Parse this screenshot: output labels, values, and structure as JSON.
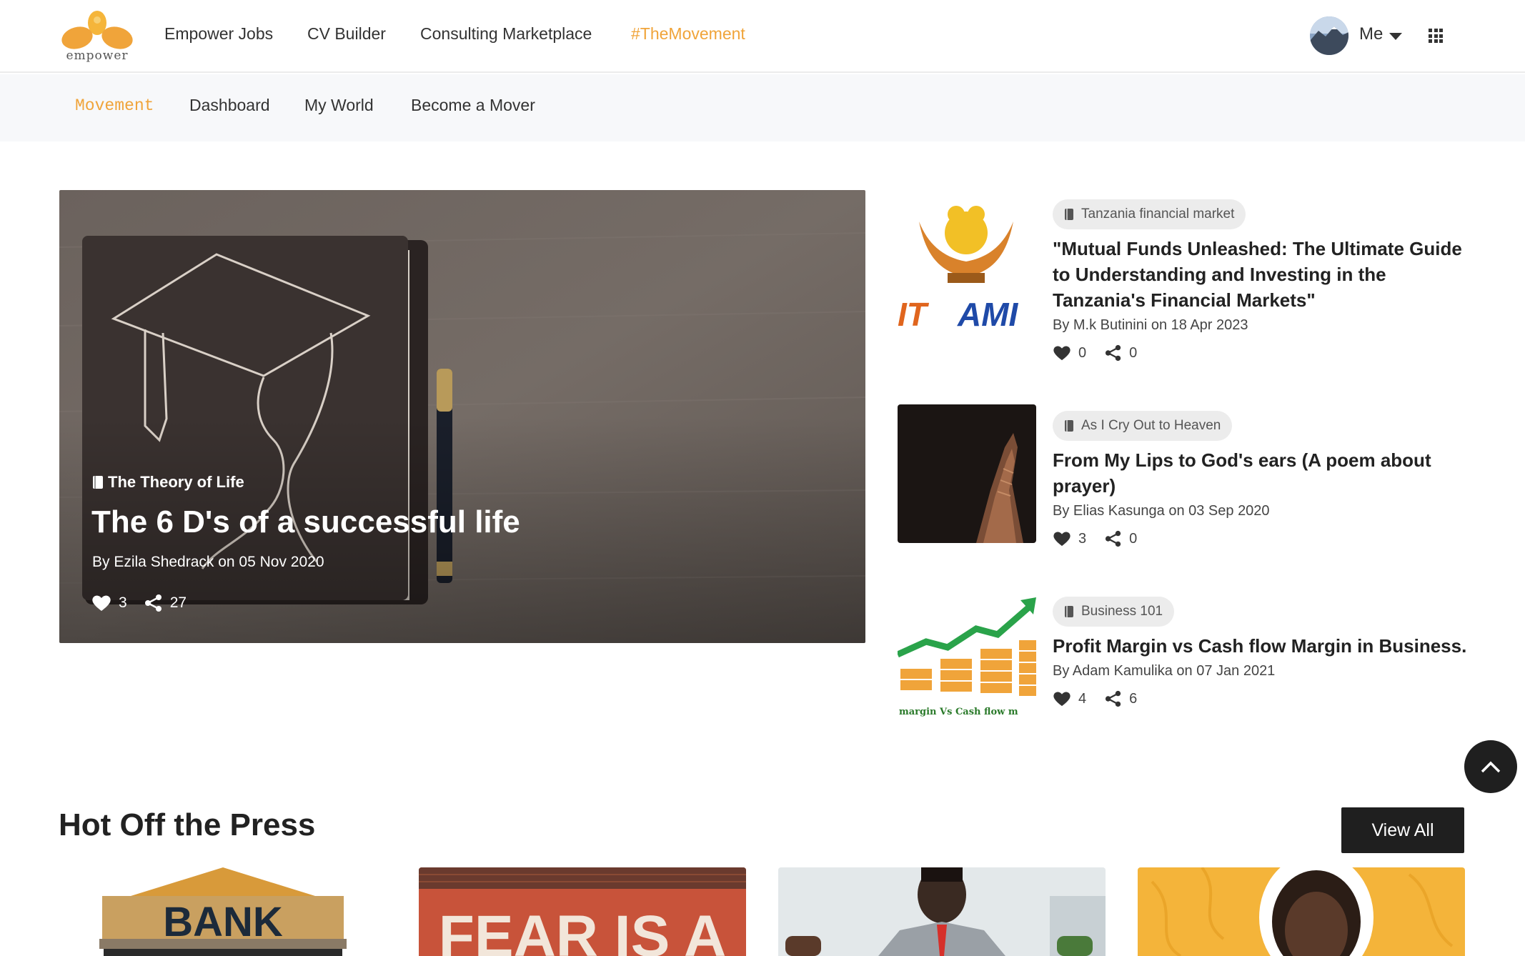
{
  "brand": {
    "logo_text": "empower"
  },
  "topnav": {
    "links": [
      "Empower Jobs",
      "CV Builder",
      "Consulting Marketplace",
      "#TheMovement"
    ],
    "active_index": 3,
    "user_label": "Me",
    "accent_color": "#f0a43a"
  },
  "subnav": {
    "brand_label": "Movement",
    "links": [
      "Dashboard",
      "My World",
      "Become a Mover"
    ]
  },
  "hero": {
    "category": "The Theory of Life",
    "title": "The 6 D's of a successful life",
    "byline": "By Ezila Shedrack on 05 Nov 2020",
    "likes": "3",
    "shares": "27"
  },
  "side_articles": [
    {
      "category": "Tanzania financial market",
      "title": "\"Mutual Funds Unleashed: The Ultimate Guide to Understanding and Investing in the Tanzania's Financial Markets\"",
      "byline": "By M.k Butinini on 18 Apr 2023",
      "likes": "0",
      "shares": "0",
      "thumb_text": "IT AMI"
    },
    {
      "category": "As I Cry Out to Heaven",
      "title": "From My Lips to God's ears (A poem about prayer)",
      "byline": "By Elias Kasunga on 03 Sep 2020",
      "likes": "3",
      "shares": "0"
    },
    {
      "category": "Business 101",
      "title": "Profit Margin vs Cash flow Margin in Business.",
      "byline": "By Adam Kamulika on 07 Jan 2021",
      "likes": "4",
      "shares": "6",
      "thumb_text": "margin Vs Cash flow m"
    }
  ],
  "press": {
    "title": "Hot Off the Press",
    "view_all_label": "View All",
    "card_texts": [
      "BANK",
      "FEAR IS A"
    ]
  },
  "icons": {
    "like": "heart-icon",
    "share": "share-icon",
    "category": "bookmark-icon",
    "apps": "grid-icon",
    "scroll_top": "chevron-up-icon"
  }
}
